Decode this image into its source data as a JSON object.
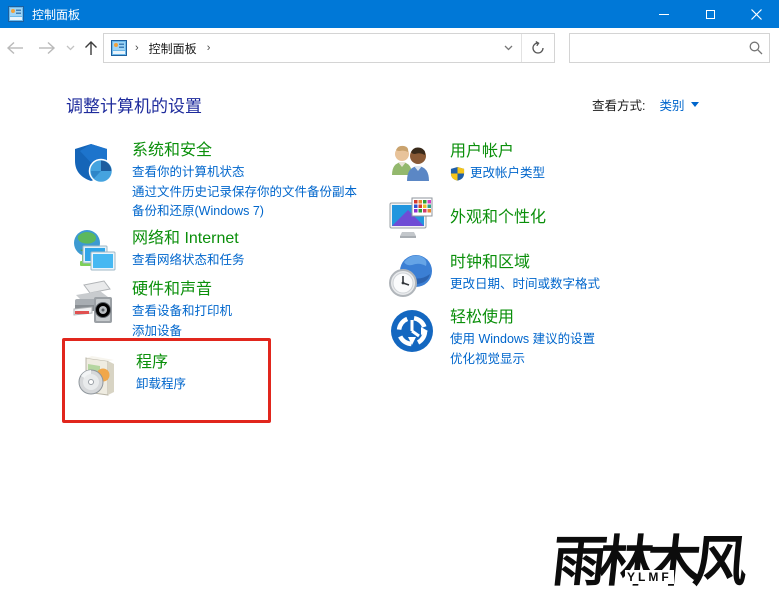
{
  "window": {
    "title": "控制面板"
  },
  "nav": {
    "separator": "›",
    "breadcrumb_root": "控制面板"
  },
  "page": {
    "heading": "调整计算机的设置",
    "view_by_label": "查看方式:",
    "view_by_value": "类别"
  },
  "categories": {
    "left": [
      {
        "title": "系统和安全",
        "links": [
          "查看你的计算机状态",
          "通过文件历史记录保存你的文件备份副本",
          "备份和还原(Windows 7)"
        ]
      },
      {
        "title": "网络和 Internet",
        "links": [
          "查看网络状态和任务"
        ]
      },
      {
        "title": "硬件和声音",
        "links": [
          "查看设备和打印机",
          "添加设备"
        ]
      },
      {
        "title": "程序",
        "links": [
          "卸载程序"
        ],
        "highlighted": true
      }
    ],
    "right": [
      {
        "title": "用户帐户",
        "links": [
          "更改帐户类型"
        ]
      },
      {
        "title": "外观和个性化",
        "links": []
      },
      {
        "title": "时钟和区域",
        "links": [
          "更改日期、时间或数字格式"
        ]
      },
      {
        "title": "轻松使用",
        "links": [
          "使用 Windows 建议的设置",
          "优化视觉显示"
        ]
      }
    ]
  },
  "watermark": {
    "text": "雨林木风",
    "subtext": "YLMF"
  },
  "colors": {
    "titlebar": "#0078d7",
    "category_title": "#0a8f0a",
    "link": "#0066cc",
    "heading": "#1e2b9c",
    "highlight_box": "#e1261d"
  }
}
